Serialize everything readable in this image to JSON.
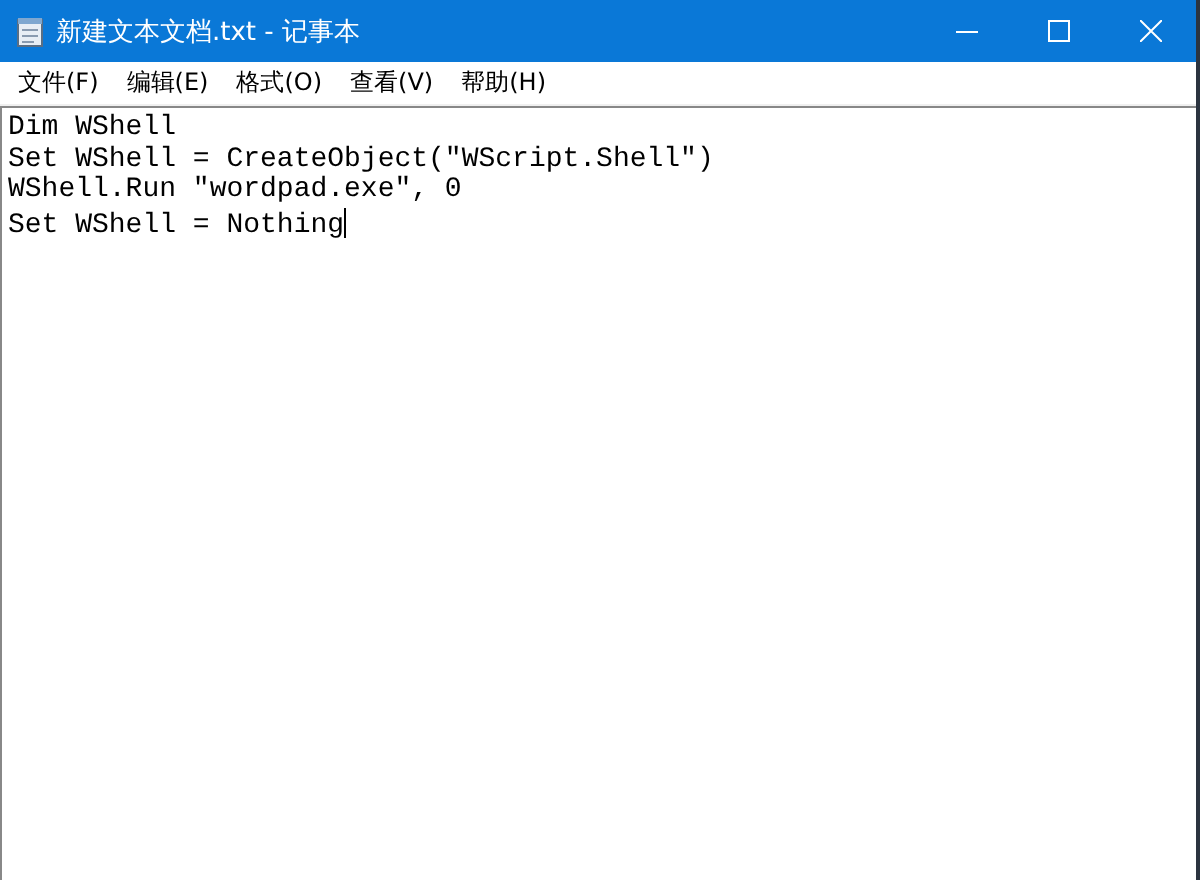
{
  "window": {
    "title": "新建文本文档.txt - 记事本"
  },
  "menu": [
    "文件(F)",
    "编辑(E)",
    "格式(O)",
    "查看(V)",
    "帮助(H)"
  ],
  "editor": {
    "lines": [
      "Dim WShell",
      "Set WShell = CreateObject(\"WScript.Shell\")",
      "WShell.Run \"wordpad.exe\", 0",
      "Set WShell = Nothing"
    ]
  }
}
